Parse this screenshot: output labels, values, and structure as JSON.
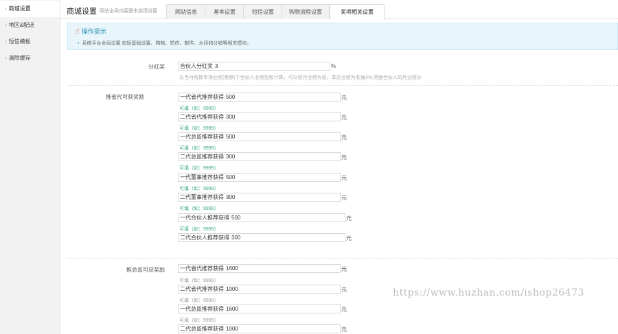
{
  "sidebar": {
    "items": [
      {
        "label": "商城设置",
        "active": true
      },
      {
        "label": "地区&配送",
        "active": false
      },
      {
        "label": "短信模板",
        "active": false
      },
      {
        "label": "清除缓存",
        "active": false
      }
    ]
  },
  "header": {
    "title": "商城设置",
    "subtitle": "网站全局内容基本选项设置",
    "tabs": [
      {
        "label": "网站信息",
        "active": false
      },
      {
        "label": "基本设置",
        "active": false
      },
      {
        "label": "短信设置",
        "active": false
      },
      {
        "label": "购物流程设置",
        "active": false
      },
      {
        "label": "奖项相关设置",
        "active": true
      }
    ]
  },
  "tips": {
    "title": "操作提示",
    "text": "系统平台全局设置,包括基础设置、购物、短信、邮件、水印和分销等相关模块。"
  },
  "dividend": {
    "label": "分红奖",
    "prefix": "合伙人分红奖",
    "value": "3",
    "unit": "%",
    "desc": "以当月线数市场业绩(差额)下合伙人业绩加权计算，可以依月业绩为准，季总业绩为准抽3%,奖励合伙人的月业绩分"
  },
  "section1": {
    "label": "推省代可获奖励",
    "rows": [
      {
        "prefix": "一代省代推荐获得",
        "value": "500",
        "unit": "元",
        "hint": "可填（如：9999）"
      },
      {
        "prefix": "二代省代推荐获得",
        "value": "300",
        "unit": "元",
        "hint": "可填（如：9999）"
      },
      {
        "prefix": "一代总监推荐获得",
        "value": "500",
        "unit": "元",
        "hint": "可填（如：9999）"
      },
      {
        "prefix": "二代总监推荐获得",
        "value": "300",
        "unit": "元",
        "hint": "可填（如：9999）"
      },
      {
        "prefix": "一代董事推荐获得",
        "value": "500",
        "unit": "元",
        "hint": "可填（如：9999）"
      },
      {
        "prefix": "二代董事推荐获得",
        "value": "300",
        "unit": "元",
        "hint": "可填（如：9999）"
      },
      {
        "prefix": "一代合伙人推荐获得",
        "value": "500",
        "unit": "元",
        "hint": "可填（如：9999）"
      },
      {
        "prefix": "二代合伙人推荐获得",
        "value": "300",
        "unit": "元",
        "hint": ""
      }
    ]
  },
  "section2": {
    "label": "推总监可获奖励",
    "rows": [
      {
        "prefix": "一代省代推荐获得",
        "value": "1600",
        "unit": "元",
        "hint": "可填（如：9999）"
      },
      {
        "prefix": "二代省代推荐获得",
        "value": "1000",
        "unit": "元",
        "hint": "可填（如：9999）"
      },
      {
        "prefix": "一代总监推荐获得",
        "value": "1600",
        "unit": "元",
        "hint": "可填（如：9999）"
      },
      {
        "prefix": "二代总监推荐获得",
        "value": "1000",
        "unit": "元",
        "hint": ""
      }
    ]
  },
  "watermark": "https://www.huzhan.com/ishop26473",
  "colors": {
    "accent": "#2c8fb2",
    "hint_green": "#39a88a",
    "tips_bg": "#e8f6fb"
  }
}
